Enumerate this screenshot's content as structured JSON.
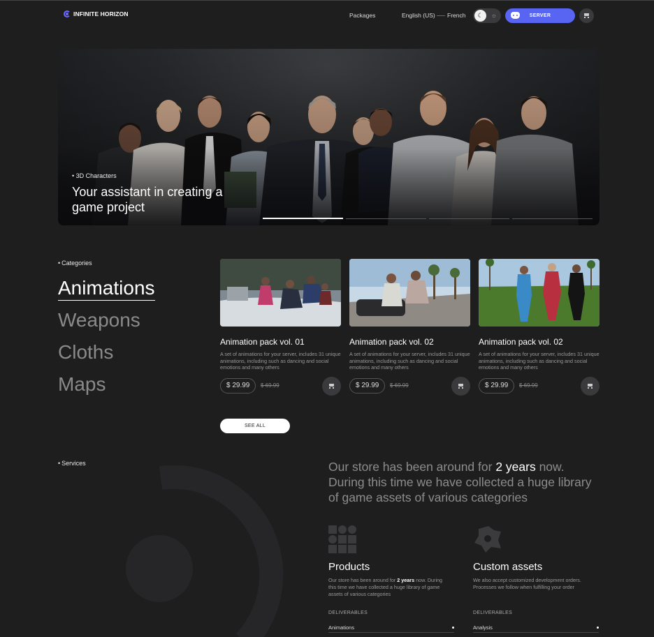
{
  "header": {
    "logo_text": "INFINITE HORIZON",
    "nav_packages": "Packages",
    "lang_english": "English (US)",
    "lang_french": "French",
    "server_label": "SERVER"
  },
  "hero": {
    "tag": "3D Characters",
    "title": "Your assistant in creating a game project"
  },
  "categories": {
    "label": "Categories",
    "items": [
      "Animations",
      "Weapons",
      "Cloths",
      "Maps"
    ],
    "active": "Animations"
  },
  "products": [
    {
      "title": "Animation pack vol. 01",
      "description": "A set of animations for your server, includes 31 unique animations, including such as dancing and social emotions and many others",
      "price": "$ 29.99",
      "old_price": "$ 69.99"
    },
    {
      "title": "Animation pack vol. 02",
      "description": "A set of animations for your server, includes 31 unique animations, including such as dancing and social emotions and many others",
      "price": "$ 29.99",
      "old_price": "$ 69.99"
    },
    {
      "title": "Animation pack vol. 02",
      "description": "A set of animations for your server, includes 31 unique animations, including such as dancing and social emotions and many others",
      "price": "$ 29.99",
      "old_price": "$ 69.99"
    }
  ],
  "see_all": "SEE ALL",
  "services": {
    "label": "Services",
    "store_pre": "Our store has been around for ",
    "store_years": "2 years",
    "store_post": " now. During this time we have collected a huge library of game assets of various categories",
    "products_title": "Products",
    "products_desc_pre": "Our store has been around for ",
    "products_desc_years": "2 years",
    "products_desc_post": " now. During this time we have collected a huge library of game assets of various categories",
    "custom_title": "Custom assets",
    "custom_desc": "We also accept customized development orders. Processes we follow when fulfilling your order",
    "deliverables_label": "DELIVERABLES",
    "products_deliverable": "Animations",
    "custom_deliverable": "Analysis"
  },
  "colors": {
    "background": "#1e1e1f",
    "accent": "#5865f2",
    "logo_accent": "#6b6cff"
  }
}
